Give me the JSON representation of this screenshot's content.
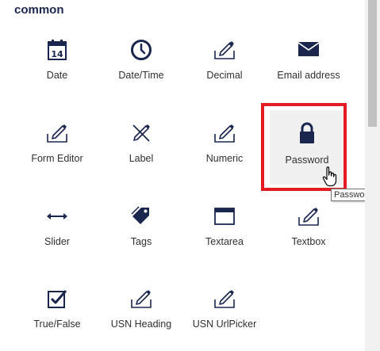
{
  "section": {
    "title": "common"
  },
  "tiles": [
    {
      "label": "Date",
      "icon": "calendar-icon"
    },
    {
      "label": "Date/Time",
      "icon": "clock-icon"
    },
    {
      "label": "Decimal",
      "icon": "pencil-edit-icon"
    },
    {
      "label": "Email address",
      "icon": "envelope-icon"
    },
    {
      "label": "Form Editor",
      "icon": "pencil-edit-icon"
    },
    {
      "label": "Label",
      "icon": "pencil-crossed-icon"
    },
    {
      "label": "Numeric",
      "icon": "pencil-edit-icon"
    },
    {
      "label": "Password",
      "icon": "lock-icon"
    },
    {
      "label": "Slider",
      "icon": "arrows-horizontal-icon"
    },
    {
      "label": "Tags",
      "icon": "tag-icon"
    },
    {
      "label": "Textarea",
      "icon": "window-icon"
    },
    {
      "label": "Textbox",
      "icon": "pencil-edit-icon"
    },
    {
      "label": "True/False",
      "icon": "checkbox-icon"
    },
    {
      "label": "USN Heading",
      "icon": "pencil-edit-icon"
    },
    {
      "label": "USN UrlPicker",
      "icon": "pencil-edit-icon"
    }
  ],
  "calendar_day": "14",
  "tooltip": "Password",
  "colors": {
    "highlight": "#e31b23",
    "icon": "#1b264f"
  }
}
